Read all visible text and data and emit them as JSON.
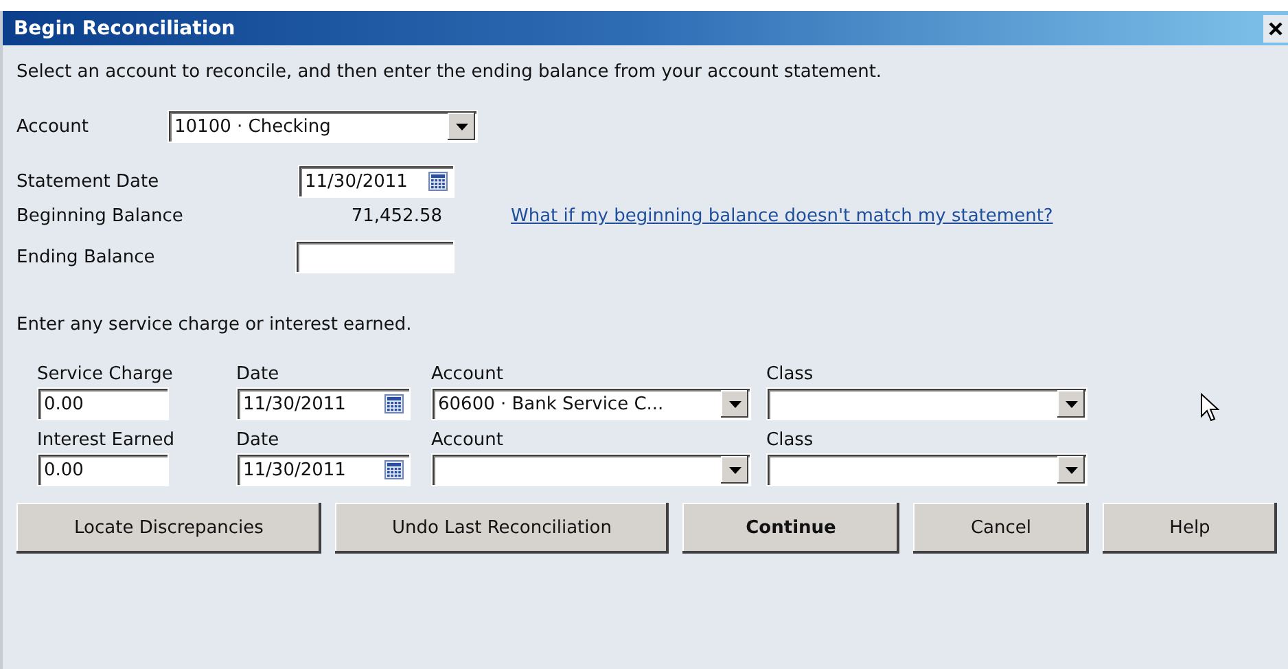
{
  "window": {
    "title": "Begin Reconciliation"
  },
  "instruction": "Select an account to reconcile, and then enter the ending balance from your account statement.",
  "account": {
    "label": "Account",
    "value": "10100 · Checking"
  },
  "statement_date": {
    "label": "Statement Date",
    "value": "11/30/2011"
  },
  "beginning_balance": {
    "label": "Beginning Balance",
    "value": "71,452.58",
    "link": "What if my beginning balance doesn't match my statement?"
  },
  "ending_balance": {
    "label": "Ending Balance"
  },
  "adjustments_instruction": "Enter any service charge or interest earned.",
  "adjustments": [
    {
      "amount_label": "Service Charge",
      "amount": "0.00",
      "date_label": "Date",
      "date": "11/30/2011",
      "account_label": "Account",
      "account": "60600 · Bank Service C...",
      "class_label": "Class"
    },
    {
      "amount_label": "Interest Earned",
      "amount": "0.00",
      "date_label": "Date",
      "date": "11/30/2011",
      "account_label": "Account",
      "class_label": "Class"
    }
  ],
  "buttons": [
    {
      "label": "Locate Discrepancies",
      "default": false
    },
    {
      "label": "Undo Last Reconciliation",
      "default": false
    },
    {
      "label": "Continue",
      "default": true
    },
    {
      "label": "Cancel",
      "default": false
    },
    {
      "label": "Help",
      "default": false
    }
  ]
}
